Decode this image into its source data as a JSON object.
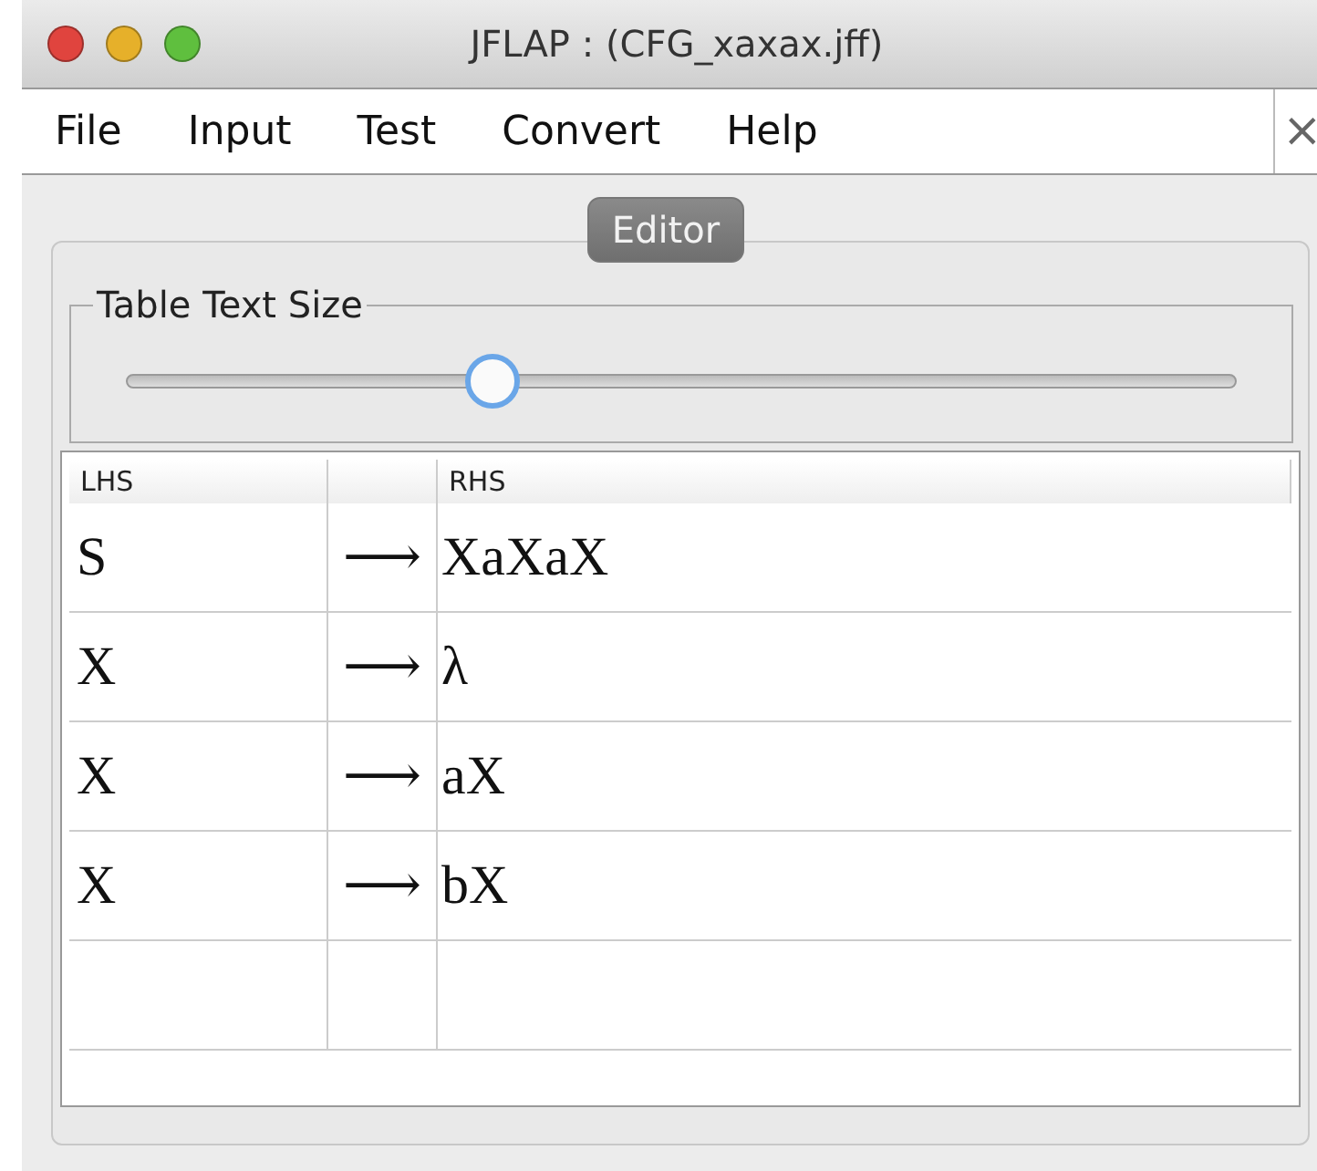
{
  "window": {
    "title": "JFLAP : (CFG_xaxax.jff)",
    "close": "×"
  },
  "menu": [
    "File",
    "Input",
    "Test",
    "Convert",
    "Help"
  ],
  "tabs": [
    {
      "label": "Editor",
      "selected": true
    }
  ],
  "text_size": {
    "label": "Table Text Size",
    "level": 0.33
  },
  "table": {
    "columns": [
      "LHS",
      "",
      "RHS"
    ],
    "rows": [
      {
        "lhs": "S",
        "arrow": "⟶",
        "rhs": "XaXaX"
      },
      {
        "lhs": "X",
        "arrow": "⟶",
        "rhs": "λ"
      },
      {
        "lhs": "X",
        "arrow": "⟶",
        "rhs": "aX"
      },
      {
        "lhs": "X",
        "arrow": "⟶",
        "rhs": "bX"
      }
    ]
  }
}
